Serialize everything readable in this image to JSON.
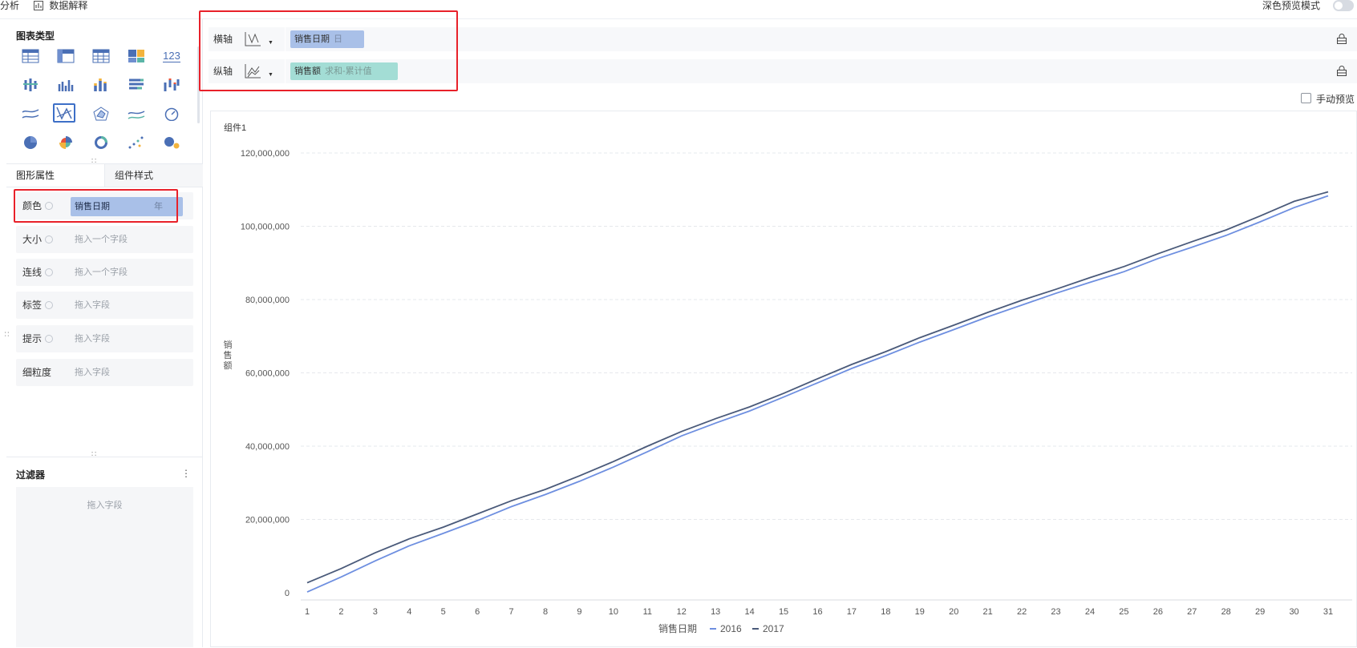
{
  "topbar": {
    "analysis": "分析",
    "data_explain": "数据解释",
    "dark_preview": "深色预览模式"
  },
  "left": {
    "chart_type_title": "图表类型",
    "icons": [
      "table-icon",
      "cross-table-icon",
      "detail-table-icon",
      "treemap-icon",
      "number-icon",
      "grouped-bar-icon",
      "column-icon",
      "stacked-column-icon",
      "horizontal-bar-icon",
      "waterfall-icon",
      "line-icon",
      "custom-line-icon",
      "radar-icon",
      "area-icon",
      "gauge-icon",
      "pie-icon",
      "rose-icon",
      "donut-icon",
      "scatter-icon",
      "bubble-icon"
    ],
    "number_glyph": "123",
    "tab_shape": "图形属性",
    "tab_style": "组件样式",
    "props": [
      {
        "label": "颜色",
        "chip": "销售日期",
        "chip_sub": "年"
      },
      {
        "label": "大小",
        "placeholder": "拖入一个字段"
      },
      {
        "label": "连线",
        "placeholder": "拖入一个字段"
      },
      {
        "label": "标签",
        "placeholder": "拖入字段"
      },
      {
        "label": "提示",
        "placeholder": "拖入字段"
      },
      {
        "label": "细粒度",
        "placeholder": "拖入字段"
      }
    ],
    "filter_title": "过滤器",
    "filter_placeholder": "拖入字段"
  },
  "axes": {
    "x": {
      "label": "横轴",
      "chip": "销售日期",
      "chip_sub": "日"
    },
    "y": {
      "label": "纵轴",
      "chip": "销售额",
      "chip_sub": "求和-累计值"
    }
  },
  "manual_preview": "手动预览",
  "chart": {
    "widget_title": "组件1"
  },
  "colors": {
    "series_2016": "#6e8fe0",
    "series_2017": "#4a5a7a",
    "chip_blue": "#a9c0e8",
    "chip_teal": "#a3ddd5",
    "highlight": "#e8212a"
  },
  "chart_data": {
    "type": "line",
    "title": "",
    "xlabel": "销售日期",
    "ylabel": "销售额",
    "ylim": [
      0,
      120000000
    ],
    "yticks": [
      "0",
      "20,000,000",
      "40,000,000",
      "60,000,000",
      "80,000,000",
      "100,000,000",
      "120,000,000"
    ],
    "legend_title": "销售日期",
    "legend_position": "bottom",
    "grid": true,
    "categories": [
      "1",
      "2",
      "3",
      "4",
      "5",
      "6",
      "7",
      "8",
      "9",
      "10",
      "11",
      "12",
      "13",
      "14",
      "15",
      "16",
      "17",
      "18",
      "19",
      "20",
      "21",
      "22",
      "23",
      "24",
      "25",
      "26",
      "27",
      "28",
      "29",
      "30",
      "31"
    ],
    "series": [
      {
        "name": "2016",
        "values": [
          200000,
          4300000,
          8700000,
          12800000,
          16200000,
          19700000,
          23500000,
          26800000,
          30400000,
          34300000,
          38500000,
          42800000,
          46300000,
          49600000,
          53400000,
          57300000,
          61200000,
          64700000,
          68400000,
          71800000,
          75300000,
          78500000,
          81700000,
          84700000,
          87600000,
          91200000,
          94300000,
          97500000,
          101200000,
          105100000,
          108300000
        ]
      },
      {
        "name": "2017",
        "values": [
          2700000,
          6600000,
          10900000,
          14700000,
          17900000,
          21500000,
          25100000,
          28200000,
          31900000,
          35800000,
          40000000,
          44000000,
          47500000,
          50700000,
          54400000,
          58400000,
          62300000,
          65800000,
          69600000,
          73000000,
          76500000,
          79800000,
          82800000,
          86000000,
          89000000,
          92500000,
          95800000,
          99000000,
          102800000,
          106800000,
          109400000
        ]
      }
    ]
  }
}
